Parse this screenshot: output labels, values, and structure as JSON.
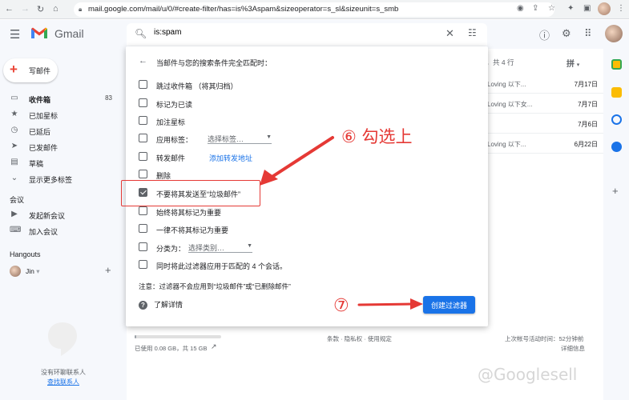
{
  "browser": {
    "url": "mail.google.com/mail/u/0/#create-filter/has=is%3Aspam&sizeoperator=s_sl&sizeunit=s_smb"
  },
  "header": {
    "logo_text": "Gmail",
    "search_value": "is:spam"
  },
  "sidebar": {
    "compose": "写邮件",
    "items": [
      {
        "label": "收件箱",
        "count": "83",
        "icon": "inbox-icon"
      },
      {
        "label": "已加星标",
        "icon": "star-icon"
      },
      {
        "label": "已延后",
        "icon": "clock-icon"
      },
      {
        "label": "已发邮件",
        "icon": "send-icon"
      },
      {
        "label": "草稿",
        "icon": "draft-icon"
      },
      {
        "label": "显示更多标签",
        "icon": "chevron-down-icon"
      }
    ],
    "meet_title": "会议",
    "meet_items": [
      {
        "label": "发起新会议",
        "icon": "video-icon"
      },
      {
        "label": "加入会议",
        "icon": "keyboard-icon"
      }
    ],
    "hangouts_title": "Hangouts",
    "hangouts_user": "Jin",
    "no_contacts": "没有环聊联系人",
    "find_contact": "查找联系人"
  },
  "mail_list": {
    "pager": "行，共 4 行",
    "input_tool": "拼",
    "rows": [
      {
        "snippet": "Loving 以下...",
        "date": "7月17日"
      },
      {
        "snippet": "Loving 以下女...",
        "date": "7月7日"
      },
      {
        "snippet": "",
        "date": "7月6日"
      },
      {
        "snippet": "Loving 以下...",
        "date": "6月22日"
      }
    ]
  },
  "footer": {
    "storage": "已使用 0.08 GB，共 15 GB",
    "storage_fraction": 0.005,
    "policy": "条款 · 隐私权 · 使用规定",
    "activity_line1": "上次帐号活动时间：52分钟前",
    "activity_line2": "详细信息"
  },
  "dialog": {
    "title": "当邮件与您的搜索条件完全匹配时：",
    "options": {
      "skip_inbox": "跳过收件箱 （将其归档）",
      "mark_read": "标记为已读",
      "star_it": "加注星标",
      "apply_label": "应用标签：",
      "label_select": "选择标签…",
      "forward": "转发邮件",
      "forward_link": "添加转发地址",
      "delete": "删除",
      "never_spam": "不要将其发送至“垃圾邮件”",
      "always_important": "始终将其标记为重要",
      "never_important": "一律不将其标记为重要",
      "categorize": "分类为：",
      "category_select": "选择类别…",
      "also_apply": "同时将此过滤器应用于匹配的 4 个会话。"
    },
    "note": "注意：过滤器不会应用到“垃圾邮件”或“已删除邮件”",
    "learn_more": "了解详情",
    "create_button": "创建过滤器"
  },
  "annotations": {
    "step6": "⑥ 勾选上",
    "step7": "⑦"
  },
  "watermark": "@Googlesell",
  "colors": {
    "accent": "#1a73e8",
    "annotation": "#e53935"
  }
}
